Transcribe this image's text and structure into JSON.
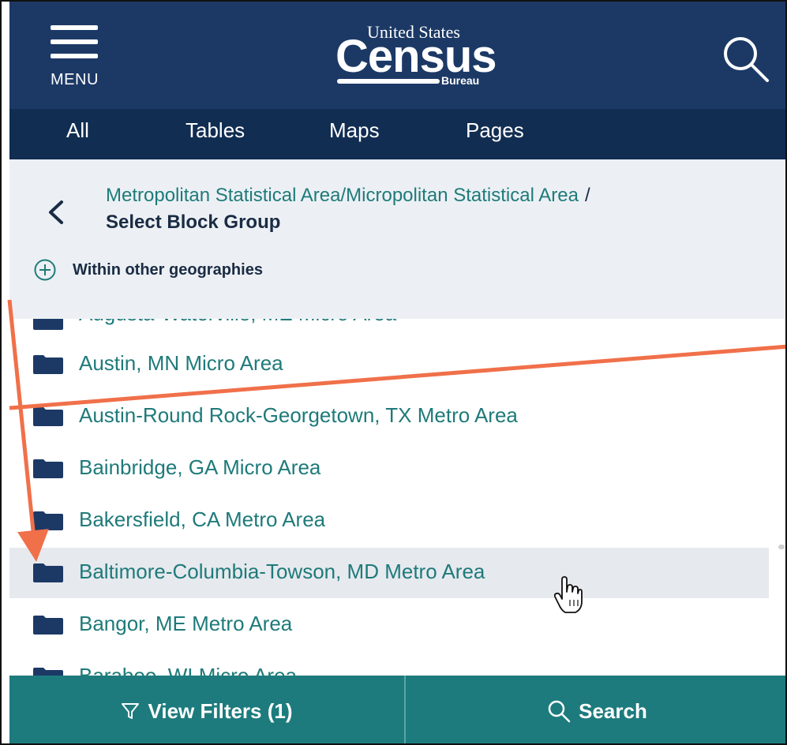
{
  "header": {
    "menu_label": "MENU",
    "logo_top": "United States",
    "logo_main": "Census",
    "logo_bottom": "Bureau"
  },
  "tabs": [
    {
      "label": "All"
    },
    {
      "label": "Tables"
    },
    {
      "label": "Maps"
    },
    {
      "label": "Pages"
    }
  ],
  "breadcrumb": {
    "parent": "Metropolitan Statistical Area/Micropolitan Statistical Area",
    "separator": "/",
    "current": "Select Block Group"
  },
  "within_label": "Within other geographies",
  "list": {
    "items": [
      {
        "label": "Augusta-Waterville, ME Micro Area"
      },
      {
        "label": "Austin, MN Micro Area"
      },
      {
        "label": "Austin-Round Rock-Georgetown, TX Metro Area"
      },
      {
        "label": "Bainbridge, GA Micro Area"
      },
      {
        "label": "Bakersfield, CA Metro Area"
      },
      {
        "label": "Baltimore-Columbia-Towson, MD Metro Area"
      },
      {
        "label": "Bangor, ME Metro Area"
      },
      {
        "label": "Baraboo, WI Micro Area"
      }
    ],
    "highlighted_index": 5
  },
  "bottom": {
    "view_filters_label": "View Filters (1)",
    "search_label": "Search"
  },
  "colors": {
    "header_bg": "#1c3966",
    "tabs_bg": "#112d52",
    "link_teal": "#1f7a7a",
    "bottom_bar": "#1d7b7d",
    "annotation_arrow": "#f0704a"
  }
}
